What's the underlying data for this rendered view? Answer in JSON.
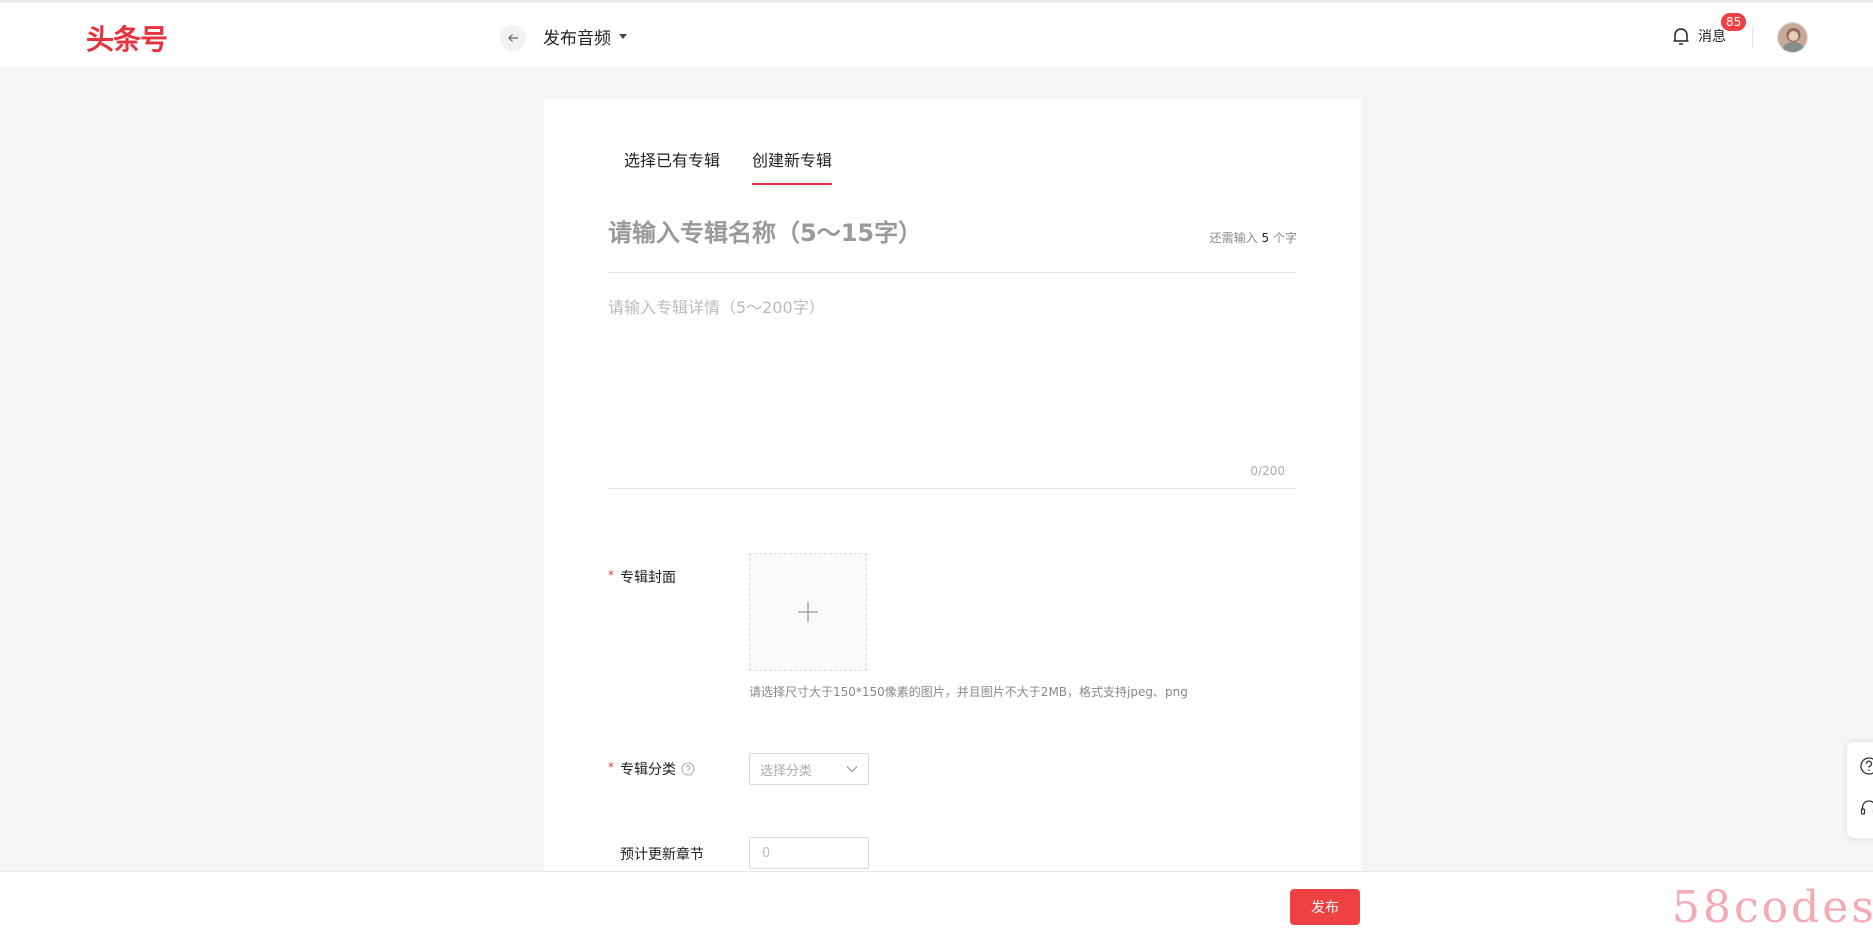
{
  "header": {
    "logo": "头条号",
    "back_icon": "arrow-left-icon",
    "title": "发布音频",
    "messages_label": "消息",
    "messages_count": "85",
    "bell_icon": "bell-icon"
  },
  "tabs": [
    {
      "label": "选择已有专辑",
      "active": false
    },
    {
      "label": "创建新专辑",
      "active": true
    }
  ],
  "album": {
    "title_placeholder": "请输入专辑名称（5～15字）",
    "title_value": "",
    "remain_prefix": "还需输入",
    "remain_count": "5",
    "remain_suffix": "个字",
    "desc_placeholder": "请输入专辑详情（5～200字）",
    "desc_value": "",
    "desc_count": "0/200"
  },
  "form": {
    "cover_label": "专辑封面",
    "cover_hint": "请选择尺寸大于150*150像素的图片，并且图片不大于2MB，格式支持jpeg、png",
    "category_label": "专辑分类",
    "category_placeholder": "选择分类",
    "chapters_label": "预计更新章节",
    "chapters_placeholder": "0",
    "required_mark": "*"
  },
  "footer": {
    "publish_label": "发布",
    "watermark": "58codes"
  },
  "colors": {
    "brand_red": "#e8313c",
    "publish_red": "#f04142",
    "background": "#f4f5f6"
  }
}
